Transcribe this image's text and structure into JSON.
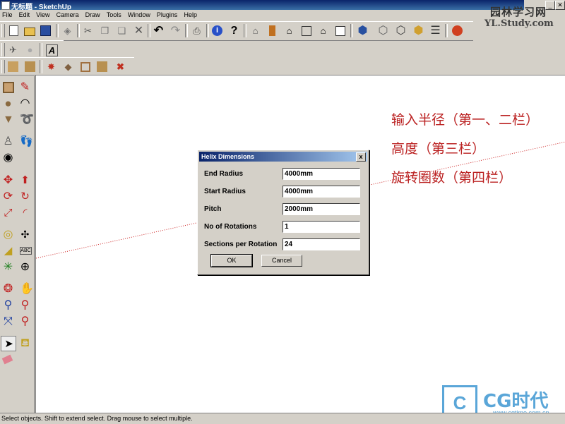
{
  "window": {
    "title": "无标题 - SketchUp"
  },
  "menu": [
    "File",
    "Edit",
    "View",
    "Camera",
    "Draw",
    "Tools",
    "Window",
    "Plugins",
    "Help"
  ],
  "window_controls": {
    "minimize": "_",
    "close": "✕"
  },
  "toolbar_icons": {
    "main": [
      "new-file-icon",
      "open-file-icon",
      "save-icon",
      "make-component-icon",
      "cut-icon",
      "copy-icon",
      "paste-icon",
      "erase-icon",
      "undo-icon",
      "redo-icon",
      "print-icon",
      "model-info-icon",
      "help-icon",
      "iso-view-icon",
      "top-view-icon",
      "front-view-icon",
      "right-view-icon",
      "back-view-icon",
      "left-view-icon",
      "xray-icon",
      "wireframe-icon",
      "hidden-line-icon",
      "shaded-icon",
      "shaded-textures-icon",
      "get-models-icon"
    ],
    "row2": [
      "camera-position-icon",
      "shadow-icon",
      "text-icon"
    ],
    "row3": [
      "sandbox-contours-icon",
      "sandbox-scratch-icon",
      "sandbox-smoove-icon",
      "sandbox-stamp-icon",
      "sandbox-drape-icon",
      "sandbox-flip-icon",
      "sandbox-add-detail-icon"
    ]
  },
  "annotations": [
    "输入半径（第一、二栏）",
    "高度（第三栏）",
    "旋转圈数（第四栏）"
  ],
  "dialog": {
    "title": "Helix Dimensions",
    "close": "x",
    "fields": [
      {
        "label": "End Radius",
        "value": "4000mm"
      },
      {
        "label": "Start Radius",
        "value": "4000mm"
      },
      {
        "label": "Pitch",
        "value": "2000mm"
      },
      {
        "label": "No of Rotations",
        "value": "1"
      },
      {
        "label": "Sections per Rotation",
        "value": "24"
      }
    ],
    "ok": "OK",
    "cancel": "Cancel"
  },
  "status": "Select objects. Shift to extend select. Drag mouse to select multiple.",
  "watermarks": {
    "top_name": "园林学习网",
    "top_url": "YL.Study.com",
    "bottom_name": "CG时代",
    "bottom_url": "www.cgtime.com.cn"
  },
  "colors": {
    "annotation": "#b22222",
    "axis_red": "#cc2222",
    "titlebar": "#0a246a",
    "watermark": "#5aa6d8"
  }
}
